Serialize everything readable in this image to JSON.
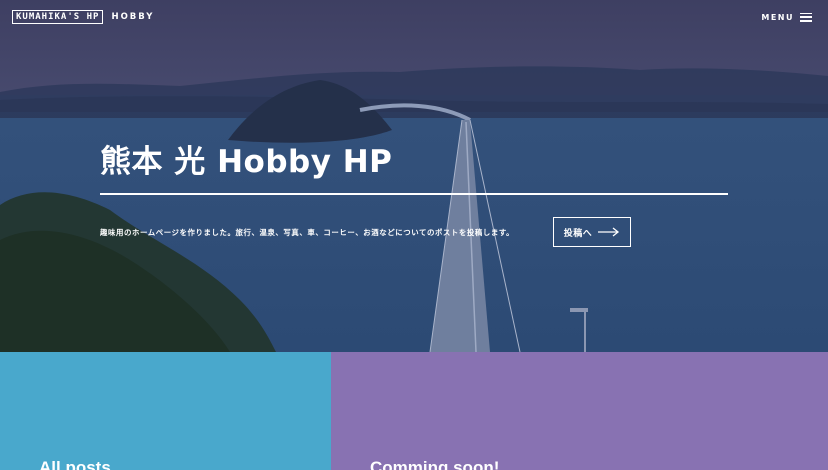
{
  "header": {
    "logo_text": "KUMAHIKA'S HP",
    "logo_sub": "HOBBY",
    "menu_label": "MENU",
    "menu_icon": "hamburger-icon"
  },
  "hero": {
    "title": "熊本 光 Hobby HP",
    "description": "趣味用のホームページを作りました。旅行、温泉、写真、車、コーヒー、お酒などについてのポストを投稿します。",
    "post_button_label": "投稿へ",
    "post_button_icon": "arrow-right-icon",
    "background_image": "bridge-over-sea-photo"
  },
  "panels": {
    "left": {
      "title": "All posts",
      "color": "#49a8cc"
    },
    "right": {
      "title": "Comming soon!",
      "color": "#8872b2"
    }
  }
}
